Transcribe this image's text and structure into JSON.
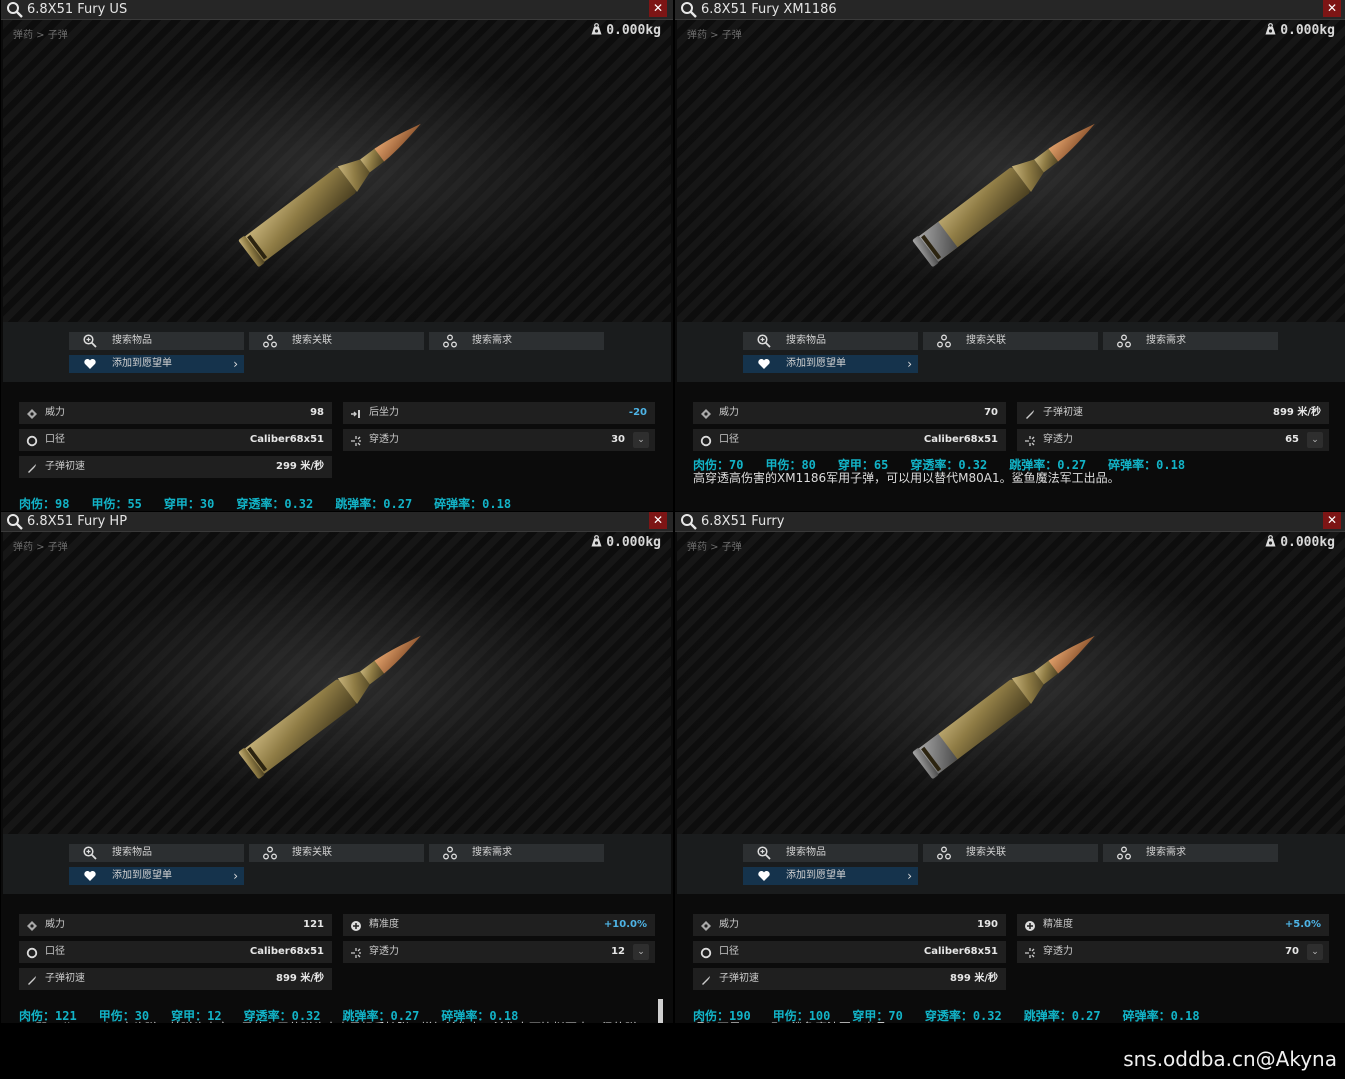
{
  "panels": [
    {
      "title": "6.8X51 Fury US",
      "breadcrumb": "弹药 > 子弹",
      "weight": "0.000kg",
      "actions": {
        "search_item": "搜索物品",
        "search_link": "搜索关联",
        "search_req": "搜索需求",
        "wishlist": "添加到愿望单"
      },
      "stats_left": [
        {
          "icon": "power-icon",
          "label": "威力",
          "value": "98"
        },
        {
          "icon": "caliber-icon",
          "label": "口径",
          "value": "Caliber68x51"
        },
        {
          "icon": "velocity-icon",
          "label": "子弹初速",
          "value": "299 米/秒"
        }
      ],
      "stats_right": [
        {
          "icon": "recoil-icon",
          "label": "后坐力",
          "value": "-20",
          "blue": true,
          "dropdown": false
        },
        {
          "icon": "penetration-icon",
          "label": "穿透力",
          "value": "30",
          "blue": false,
          "dropdown": true
        }
      ],
      "damage": [
        "肉伤：98",
        "甲伤：55",
        "穿甲：30",
        "穿透率：0.32",
        "跳弹率：0.27",
        "碎弹率：0.18"
      ],
      "description": ""
    },
    {
      "title": "6.8X51 Fury XM1186",
      "breadcrumb": "弹药 > 子弹",
      "weight": "0.000kg",
      "actions": {
        "search_item": "搜索物品",
        "search_link": "搜索关联",
        "search_req": "搜索需求",
        "wishlist": "添加到愿望单"
      },
      "stats_left": [
        {
          "icon": "power-icon",
          "label": "威力",
          "value": "70"
        },
        {
          "icon": "caliber-icon",
          "label": "口径",
          "value": "Caliber68x51"
        }
      ],
      "stats_right": [
        {
          "icon": "velocity-icon",
          "label": "子弹初速",
          "value": "899 米/秒",
          "blue": false,
          "dropdown": false
        },
        {
          "icon": "penetration-icon",
          "label": "穿透力",
          "value": "65",
          "blue": false,
          "dropdown": true
        }
      ],
      "damage": [
        "肉伤：70",
        "甲伤：80",
        "穿甲：65",
        "穿透率：0.32",
        "跳弹率：0.27",
        "碎弹率：0.18"
      ],
      "description": "高穿透高伤害的XM1186军用子弹，可以用以替代M80A1。鲨鱼魔法军工出品。"
    },
    {
      "title": "6.8X51 Fury HP",
      "breadcrumb": "弹药 > 子弹",
      "weight": "0.000kg",
      "actions": {
        "search_item": "搜索物品",
        "search_link": "搜索关联",
        "search_req": "搜索需求",
        "wishlist": "添加到愿望单"
      },
      "stats_left": [
        {
          "icon": "power-icon",
          "label": "威力",
          "value": "121"
        },
        {
          "icon": "caliber-icon",
          "label": "口径",
          "value": "Caliber68x51"
        },
        {
          "icon": "velocity-icon",
          "label": "子弹初速",
          "value": "899 米/秒"
        }
      ],
      "stats_right": [
        {
          "icon": "accuracy-icon",
          "label": "精准度",
          "value": "+10.0%",
          "blue": true,
          "dropdown": false
        },
        {
          "icon": "penetration-icon",
          "label": "穿透力",
          "value": "12",
          "blue": false,
          "dropdown": true
        }
      ],
      "damage": [
        "肉伤：121",
        "甲伤：30",
        "穿甲：12",
        "穿透率：0.32",
        "跳弹率：0.27",
        "碎弹率：0.18"
      ],
      "description": "HP即Hollow Point空头弹。其弹头中空，目的在于使弹头击中目标后扩张，增加杀伤力。杀伤力可比拟更大口径的弹头，同时避免穿透目标，当然也打不穿甲。这种弹药被用于运动和狩猎Tagilla。鲨鱼魔法军工出品。"
    },
    {
      "title": "6.8X51 Furry",
      "breadcrumb": "弹药 > 子弹",
      "weight": "0.000kg",
      "actions": {
        "search_item": "搜索物品",
        "search_link": "搜索关联",
        "search_req": "搜索需求",
        "wishlist": "添加到愿望单"
      },
      "stats_left": [
        {
          "icon": "power-icon",
          "label": "威力",
          "value": "190"
        },
        {
          "icon": "caliber-icon",
          "label": "口径",
          "value": "Caliber68x51"
        },
        {
          "icon": "velocity-icon",
          "label": "子弹初速",
          "value": "899 米/秒"
        }
      ],
      "stats_right": [
        {
          "icon": "accuracy-icon",
          "label": "精准度",
          "value": "+5.0%",
          "blue": true,
          "dropdown": false
        },
        {
          "icon": "penetration-icon",
          "label": "穿透力",
          "value": "70",
          "blue": false,
          "dropdown": true
        }
      ],
      "damage": [
        "肉伤：190",
        "甲伤：100",
        "穿甲：70",
        "穿透率：0.32",
        "跳弹率：0.27",
        "碎弹率：0.18"
      ],
      "description": "嗯？不是Fury吗。鲨鱼魔法军工出品。"
    }
  ],
  "watermark": "sns.oddba.cn@Akyna",
  "colors": {
    "damage_text": "#12b3c7",
    "positive_value": "#4eb4e6",
    "close_button": "#7d1515",
    "wishlist_button": "#15334c"
  }
}
